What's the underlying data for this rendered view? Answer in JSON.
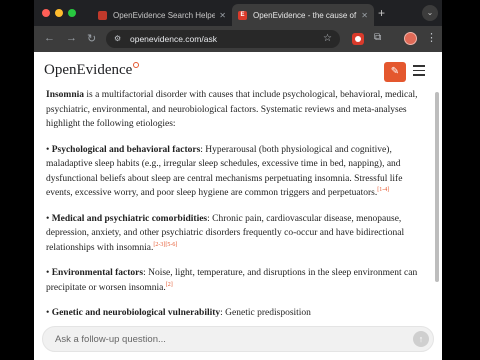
{
  "browser": {
    "tabs": [
      {
        "favicon": "",
        "title": "OpenEvidence Search Helper"
      },
      {
        "favicon": "E",
        "title": "OpenEvidence - the cause of"
      }
    ],
    "url": "openevidence.com/ask"
  },
  "header": {
    "logo_text": "OpenEvidence"
  },
  "article": {
    "intro_term": "Insomnia",
    "intro_text": " is a multifactorial disorder with causes that include psychological, behavioral, medical, psychiatric, environmental, and neurobiological factors. Systematic reviews and meta-analyses highlight the following etiologies:",
    "items": [
      {
        "term": "Psychological and behavioral factors",
        "text": ": Hyperarousal (both physiological and cognitive), maladaptive sleep habits (e.g., irregular sleep schedules, excessive time in bed, napping), and dysfunctional beliefs about sleep are central mechanisms perpetuating insomnia. Stressful life events, excessive worry, and poor sleep hygiene are common triggers and perpetuators.",
        "cite": "[1-4]"
      },
      {
        "term": "Medical and psychiatric comorbidities",
        "text": ": Chronic pain, cardiovascular disease, menopause, depression, anxiety, and other psychiatric disorders frequently co-occur and have bidirectional relationships with insomnia.",
        "cite": "[2-3][5-6]"
      },
      {
        "term": "Environmental factors",
        "text": ": Noise, light, temperature, and disruptions in the sleep environment can precipitate or worsen insomnia.",
        "cite": "[2]"
      },
      {
        "term": "Genetic and neurobiological vulnerability",
        "text": ": Genetic predisposition",
        "cite": ""
      }
    ]
  },
  "followup": {
    "placeholder": "Ask a follow-up question..."
  },
  "colors": {
    "accent": "#e4572e",
    "chrome_dark": "#202124",
    "toolbar": "#3c3c3c"
  }
}
